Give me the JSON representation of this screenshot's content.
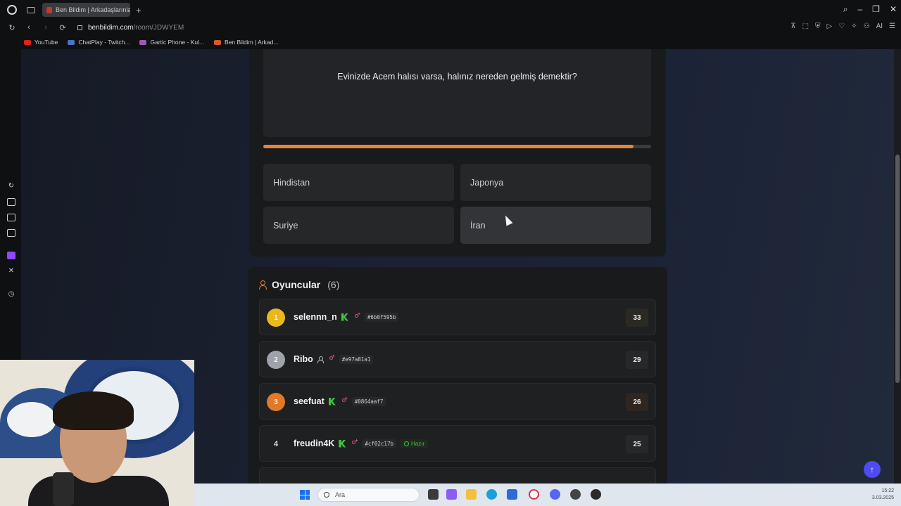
{
  "browser": {
    "tab_title": "Ben Bildim | Arkadaşlarınla",
    "url_host": "benbildim.com",
    "url_path": "/room/JDWYEM",
    "new_tab": "+",
    "ai_label": "AI",
    "bookmarks": [
      {
        "label": "YouTube",
        "color": "#e62117"
      },
      {
        "label": "ChatPlay - Twitch...",
        "color": "#4a73c7"
      },
      {
        "label": "Gartic Phone - Kul...",
        "color": "#9b59b6"
      },
      {
        "label": "Ben Bildim | Arkad...",
        "color": "#d9572b"
      }
    ]
  },
  "question": {
    "text": "Evinizde Acem halısı varsa, halınız nereden gelmiş demektir?",
    "progress": 0.955,
    "progress_color": "#e8833a"
  },
  "answers": [
    {
      "label": "Hindistan"
    },
    {
      "label": "Japonya"
    },
    {
      "label": "Suriye"
    },
    {
      "label": "İran"
    }
  ],
  "players": {
    "title": "Oyuncular",
    "count": "(6)",
    "list": [
      {
        "rank": "1",
        "name": "selennn_n",
        "tag": "#6b0f595b",
        "score": "33",
        "ready": ""
      },
      {
        "rank": "2",
        "name": "Ribo",
        "tag": "#e97a81a1",
        "score": "29",
        "ready": ""
      },
      {
        "rank": "3",
        "name": "seefuat",
        "tag": "#0864aaf7",
        "score": "26",
        "ready": ""
      },
      {
        "rank": "4",
        "name": "freudin4K",
        "tag": "#cf02c17b",
        "score": "25",
        "ready": "Hazır"
      }
    ]
  },
  "taskbar": {
    "search_placeholder": "Ara",
    "time": "15:22",
    "date": "3.03.2025"
  }
}
